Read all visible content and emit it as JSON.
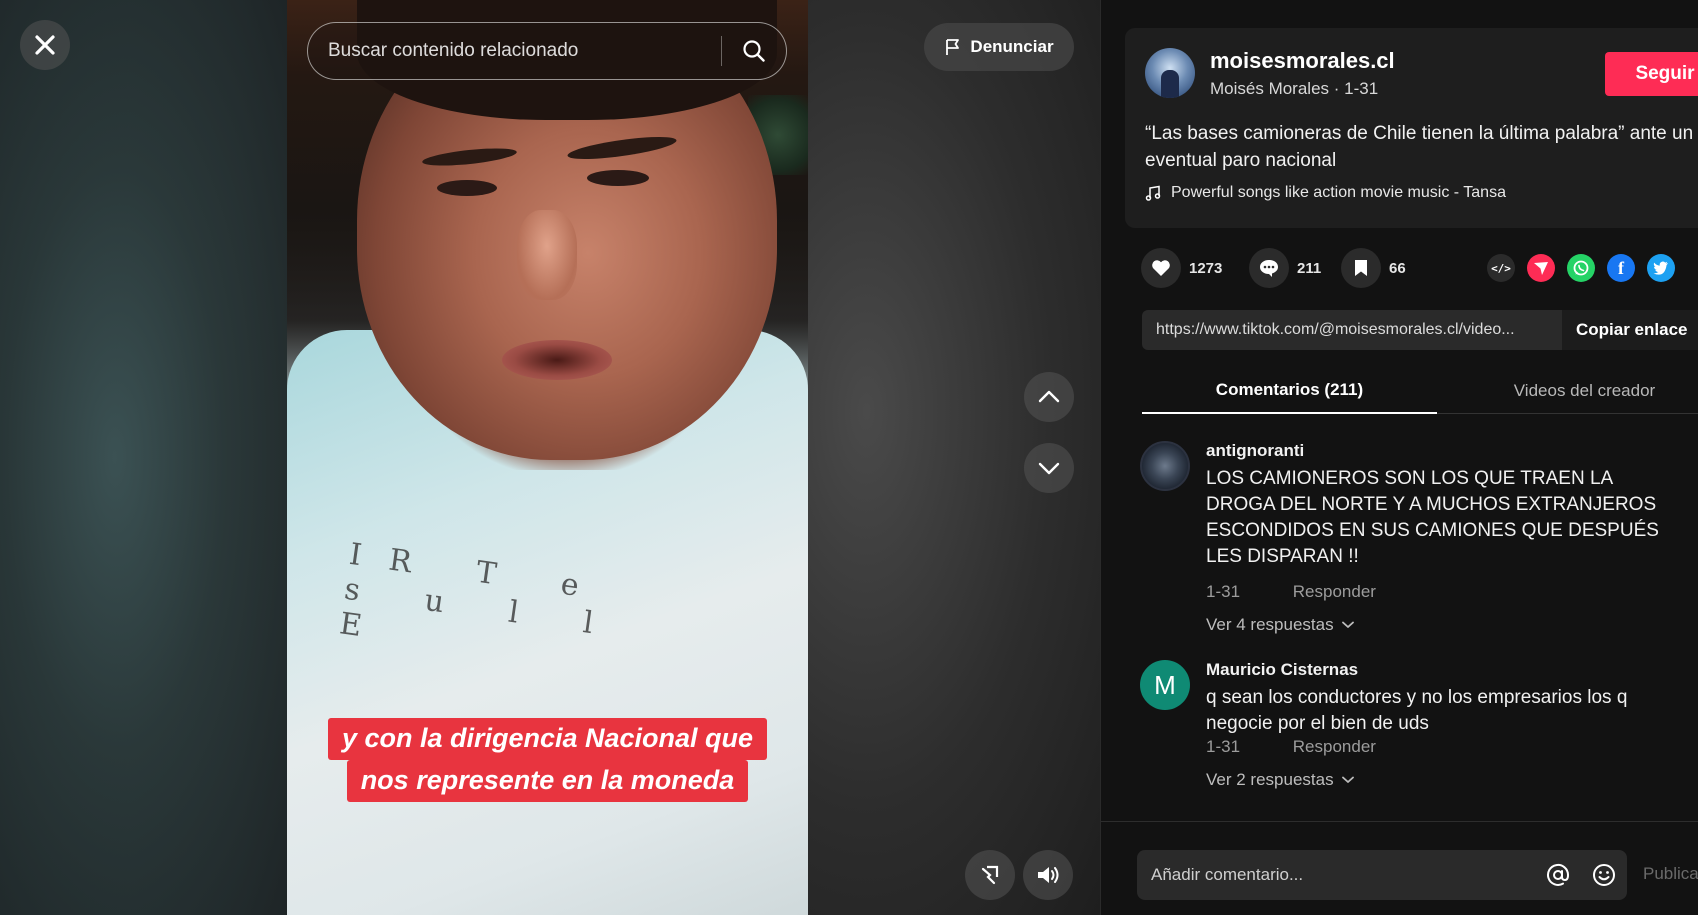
{
  "player": {
    "search_placeholder": "Buscar contenido relacionado",
    "report_label": "Denunciar",
    "caption_lines": [
      "y con la dirigencia Nacional que",
      "nos represente en la moneda"
    ],
    "shirt_print": "IR T e s u l l E"
  },
  "author": {
    "username": "moisesmorales.cl",
    "subline": "Moisés Morales · 1-31",
    "follow_label": "Seguir",
    "description": "“Las bases camioneras de Chile tienen la última palabra” ante un eventual paro nacional",
    "music": "Powerful songs like action movie music - Tansa"
  },
  "stats": {
    "likes": "1273",
    "comments": "211",
    "saves": "66"
  },
  "share": {
    "embed_icon": "</>",
    "facebook_icon": "f"
  },
  "link": {
    "url": "https://www.tiktok.com/@moisesmorales.cl/video...",
    "copy_label": "Copiar enlace"
  },
  "tabs": {
    "comments": "Comentarios (211)",
    "videos": "Videos del creador"
  },
  "comments": [
    {
      "user": "antignoranti",
      "text": "LOS CAMIONEROS SON LOS QUE TRAEN LA DROGA DEL NORTE Y A MUCHOS EXTRANJEROS ESCONDIDOS EN SUS CAMIONES QUE DESPUÉS LES DISPARAN !!",
      "date": "1-31",
      "reply_label": "Responder",
      "replies_label": "Ver 4 respuestas"
    },
    {
      "user": "Mauricio Cisternas",
      "avatar_letter": "M",
      "text": "q sean los conductores y no los empresarios los q negocie por el bien de uds",
      "date": "1-31",
      "reply_label": "Responder",
      "replies_label": "Ver 2 respuestas"
    }
  ],
  "composer": {
    "placeholder": "Añadir comentario...",
    "post_label": "Publicar"
  },
  "colors": {
    "accent": "#fe2c55",
    "caption_bg": "#e8343f",
    "whatsapp": "#25d366",
    "facebook": "#1877f2",
    "twitter": "#1da1f2",
    "avatar_m": "#0f8a74"
  }
}
